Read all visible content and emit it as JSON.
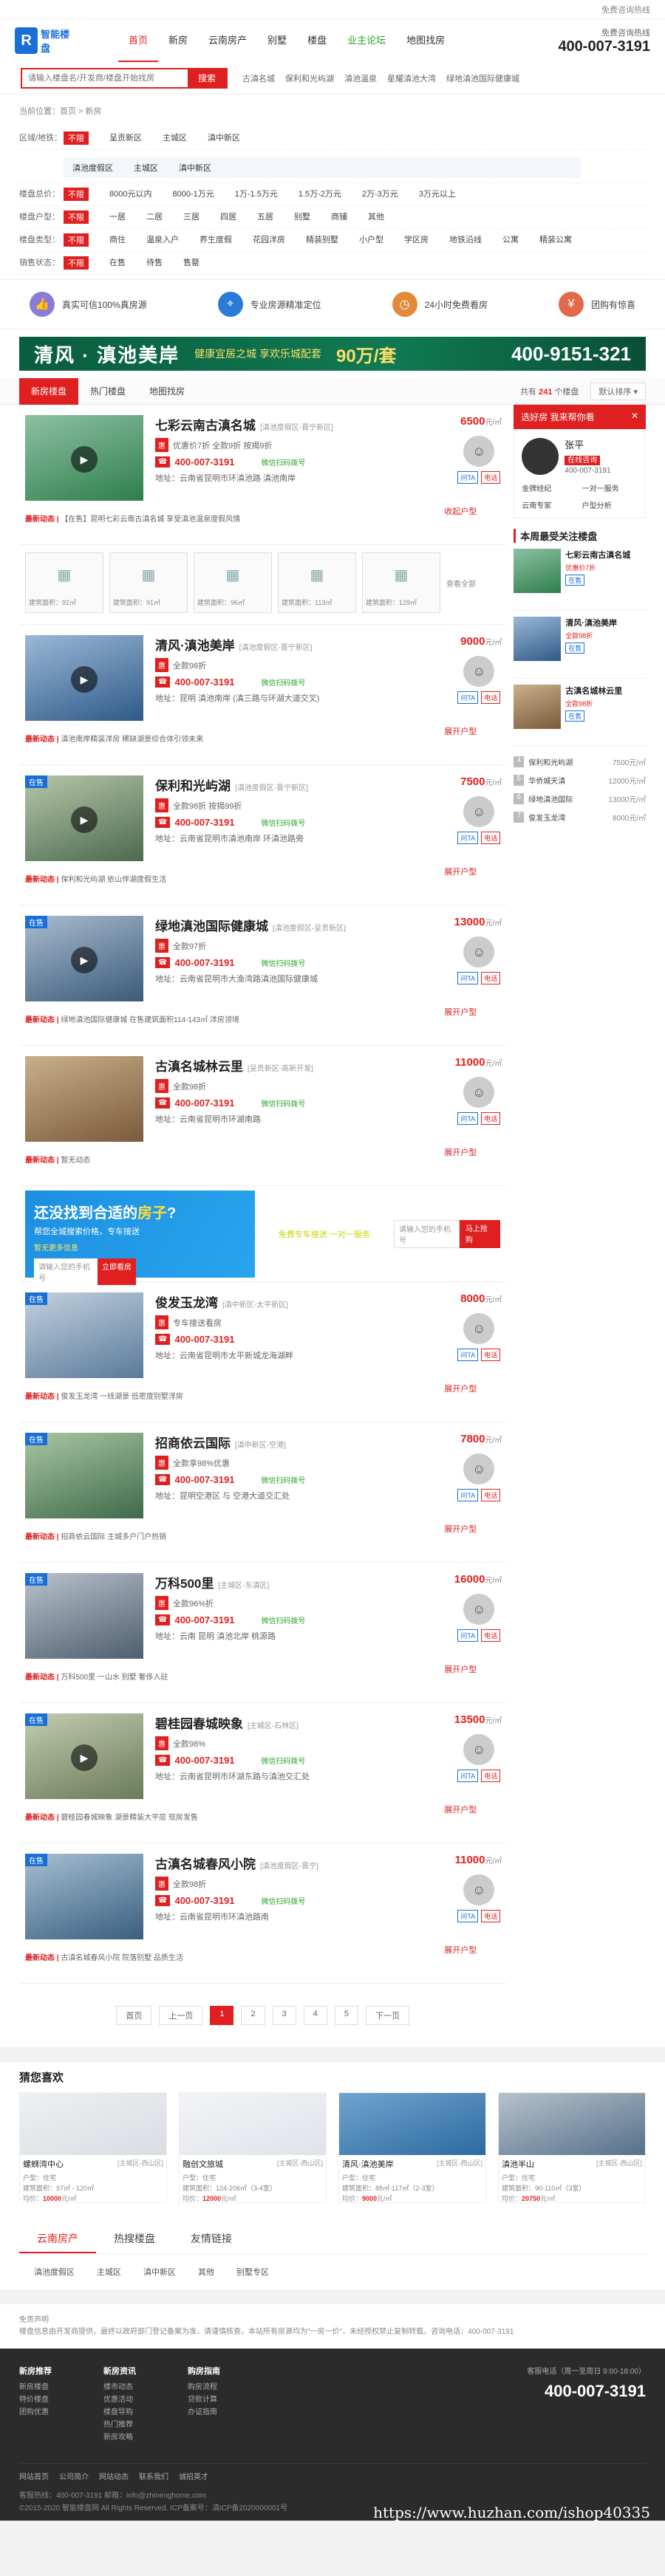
{
  "top": {
    "welcome": "",
    "hotline_label": "免费咨询热线",
    "hotline": "400-007-3191"
  },
  "logo": {
    "mark": "R",
    "text": "智能楼盘"
  },
  "nav": [
    "首页",
    "新房",
    "云南房产",
    "别墅",
    "楼盘",
    "业主论坛",
    "地图找房"
  ],
  "search": {
    "placeholder": "请输入楼盘名/开发商/楼盘开始找房",
    "button": "搜索",
    "hot": [
      "古滇名城",
      "保利和光屿湖",
      "滇池温泉",
      "星耀滇池大湾",
      "绿地滇池国际健康城"
    ]
  },
  "crumb": "当前位置：首页 > 新房",
  "filters": [
    {
      "label": "区域/地铁：",
      "opts": [
        "不限",
        "呈贡新区",
        "主城区",
        "滇中新区"
      ]
    },
    {
      "label": "",
      "sub": [
        "滇池度假区",
        "主城区",
        "滇中新区"
      ]
    },
    {
      "label": "楼盘总价：",
      "opts": [
        "不限",
        "8000元以内",
        "8000-1万元",
        "1万-1.5万元",
        "1.5万-2万元",
        "2万-3万元",
        "3万元以上"
      ]
    },
    {
      "label": "楼盘户型：",
      "opts": [
        "不限",
        "一居",
        "二居",
        "三居",
        "四居",
        "五居",
        "别墅",
        "商铺",
        "其他"
      ]
    },
    {
      "label": "楼盘类型：",
      "opts": [
        "不限",
        "商住",
        "温泉入户",
        "养生度假",
        "花园洋房",
        "精装别墅",
        "小户型",
        "学区房",
        "地铁沿线",
        "公寓",
        "精装公寓"
      ]
    },
    {
      "label": "销售状态：",
      "opts": [
        "不限",
        "在售",
        "待售",
        "售罄"
      ]
    }
  ],
  "features": [
    {
      "icon": "thumb-icon",
      "text": "真实可信100%真房源",
      "color": "#8a7bd8"
    },
    {
      "icon": "location-icon",
      "text": "专业房源精准定位",
      "color": "#2a7bd8"
    },
    {
      "icon": "clock-icon",
      "text": "24小时免费看房",
      "color": "#e08a3a"
    },
    {
      "icon": "sale-icon",
      "text": "团购有惊喜",
      "color": "#e06a4a"
    }
  ],
  "banner": {
    "t1": "清风 · 滇池美岸",
    "t2": "健康宜居之城  享欢乐城配套",
    "t3": "90万/套",
    "t4": "400-9151-321"
  },
  "tabs": {
    "items": [
      "新房楼盘",
      "热门楼盘",
      "地图找房"
    ],
    "total_prefix": "共有",
    "total": "241",
    "total_suffix": "个楼盘",
    "sort": "默认排序"
  },
  "list": [
    {
      "name": "七彩云南古滇名城",
      "area": "[滇池度假区-晋宁新区]",
      "price": "6500",
      "unit": "元/㎡",
      "tags": "优惠价7折  全款9折  按揭9折",
      "tel": "400-007-3191",
      "mini": "微信扫码拨号",
      "addr": "地址：云南省昆明市环滇池路 滇池南岸",
      "news": "【在售】昆明七彩云南古滇名城 享受滇池温泉度假风情",
      "tag": "",
      "video": true,
      "show": "收起户型"
    },
    {
      "name": "清风·滇池美岸",
      "area": "[滇池度假区-晋宁新区]",
      "price": "9000",
      "unit": "元/㎡",
      "tags": "全款98折",
      "tel": "400-007-3191",
      "mini": "微信扫码拨号",
      "addr": "地址：昆明  滇池南岸  (滇三路与环湖大道交叉)",
      "news": "滇池南岸精装洋房 稀缺湖景综合体引领未来",
      "tag": "",
      "video": true,
      "show": "展开户型"
    },
    {
      "name": "保利和光屿湖",
      "area": "[滇池度假区-晋宁新区]",
      "price": "7500",
      "unit": "元/㎡",
      "tags": "全款98折  按揭99折",
      "tel": "400-007-3191",
      "mini": "微信扫码拨号",
      "addr": "地址：云南省昆明市滇池南岸  环滇池路旁",
      "news": "保利和光屿湖 依山伴湖度假生活",
      "tag": "在售",
      "video": true,
      "show": "展开户型"
    },
    {
      "name": "绿地滇池国际健康城",
      "area": "[滇池度假区-呈贡新区]",
      "price": "13000",
      "unit": "元/㎡",
      "tags": "全款97折",
      "tel": "400-007-3191",
      "mini": "微信扫码拨号",
      "addr": "地址：云南省昆明市大渔湾路滇池国际健康城",
      "news": "绿地滇池国际健康城 在售建筑面积114-143㎡ 洋房领境",
      "tag": "在售",
      "video": true,
      "show": "展开户型"
    },
    {
      "name": "古滇名城林云里",
      "area": "[呈贡新区-高新开发]",
      "price": "11000",
      "unit": "元/㎡",
      "tags": "全款98折",
      "tel": "400-007-3191",
      "mini": "微信扫码拨号",
      "addr": "地址：云南省昆明市环湖南路",
      "news": "暂无动态",
      "tag": "",
      "video": false,
      "show": "展开户型"
    },
    {
      "name": "俊发玉龙湾",
      "area": "[滇中新区-太平新区]",
      "price": "8000",
      "unit": "元/㎡",
      "tags": "专车接送看房",
      "tel": "400-007-3191",
      "mini": "",
      "addr": "地址：云南省昆明市太平新城龙海湖畔",
      "news": "俊发玉龙湾 一线湖景 低密度别墅洋房",
      "tag": "在售",
      "video": false,
      "show": "展开户型"
    },
    {
      "name": "招商依云国际",
      "area": "[滇中新区-空港]",
      "price": "7800",
      "unit": "元/㎡",
      "tags": "全款享98%优惠",
      "tel": "400-007-3191",
      "mini": "微信扫码拨号",
      "addr": "地址：昆明空港区 与 空港大道交汇处",
      "news": "招商依云国际 主城多户门户热销",
      "tag": "在售",
      "video": false,
      "show": "展开户型"
    },
    {
      "name": "万科500里",
      "area": "[主城区-东滇区]",
      "price": "16000",
      "unit": "元/㎡",
      "tags": "全款96%折",
      "tel": "400-007-3191",
      "mini": "微信扫码拨号",
      "addr": "地址：云南 昆明 滇池北岸 桃源路",
      "news": "万科500里 一山水 别墅 奢侈入驻",
      "tag": "在售",
      "video": false,
      "show": "展开户型"
    },
    {
      "name": "碧桂园春城映象",
      "area": "[主城区-石林区]",
      "price": "13500",
      "unit": "元/㎡",
      "tags": "全款98%",
      "tel": "400-007-3191",
      "mini": "微信扫码拨号",
      "addr": "地址：云南省昆明市环湖东路与滇池交汇处",
      "news": "碧桂园春城映象 湖景精装大平层 现房发售",
      "tag": "在售",
      "video": true,
      "show": "展开户型"
    },
    {
      "name": "古滇名城春风小院",
      "area": "[滇池度假区-晋宁]",
      "price": "11000",
      "unit": "元/㎡",
      "tags": "全款98折",
      "tel": "400-007-3191",
      "mini": "微信扫码拨号",
      "addr": "地址：云南省昆明市环滇池路南",
      "news": "古滇名城春风小院 院落别墅 品质生活",
      "tag": "在售",
      "video": false,
      "show": "展开户型"
    }
  ],
  "hutypes": [
    {
      "cap": "建筑面积：92㎡"
    },
    {
      "cap": "建筑面积：91㎡"
    },
    {
      "cap": "建筑面积：96㎡"
    },
    {
      "cap": "建筑面积：113㎡"
    },
    {
      "cap": "建筑面积：129㎡"
    }
  ],
  "hu_more": "查看全部",
  "promo": {
    "t1a": "还没找到合适的",
    "t1b": "房子",
    "t1c": "?",
    "t2": "帮您全城搜索价格，专车接送",
    "t3": "暂无更多信息",
    "phone": "请输入您的手机号",
    "btn": "立即看房",
    "mid": "免费专车接送  一对一服务",
    "phone2": "请输入您的手机号",
    "btn2": "马上抢购"
  },
  "pager": [
    "首页",
    "上一页",
    "1",
    "2",
    "3",
    "4",
    "5",
    "下一页"
  ],
  "side": {
    "head": "选好房 我来帮你看",
    "agent_name": "张平",
    "agent_badge": "在线咨询",
    "agent_phone": "400-007-3191",
    "grid": [
      "金牌经纪",
      "一对一服务",
      "云南专家",
      "户型分析"
    ],
    "title": "本周最受关注楼盘",
    "items": [
      {
        "name": "七彩云南古滇名城",
        "sub": "优惠价7折",
        "tag": "在售"
      },
      {
        "name": "清风·滇池美岸",
        "sub": "全款98折",
        "tag": "在售"
      },
      {
        "name": "古滇名城林云里",
        "sub": "全款98折",
        "tag": "在售"
      }
    ],
    "rank": [
      {
        "n": "4",
        "name": "保利和光屿湖",
        "p": "7500元/㎡"
      },
      {
        "n": "5",
        "name": "华侨城天滇",
        "p": "12000元/㎡"
      },
      {
        "n": "6",
        "name": "绿地滇池国际",
        "p": "13000元/㎡"
      },
      {
        "n": "7",
        "name": "俊发玉龙湾",
        "p": "8000元/㎡"
      }
    ]
  },
  "guess": {
    "title": "猜您喜欢",
    "cards": [
      {
        "name": "螺蛳湾中心",
        "area": "[主城区-西山区]",
        "type": "住宅",
        "size": "建筑面积：97㎡ - 120㎡",
        "price": "10000",
        "c1": "#d9dde2",
        "c2": "#eef0f2"
      },
      {
        "name": "融创文旅城",
        "area": "[主城区-西山区]",
        "type": "住宅",
        "size": "建筑面积：124-206㎡（3-4室）",
        "price": "12000",
        "c1": "#dfe3ea",
        "c2": "#f3f4f6"
      },
      {
        "name": "清风·滇池美岸",
        "area": "[主城区-西山区]",
        "type": "住宅",
        "size": "建筑面积：88㎡-117㎡（2-3室）",
        "price": "9000",
        "c1": "#2d6aa0",
        "c2": "#6fa4cf"
      },
      {
        "name": "滇池半山",
        "area": "[主城区-西山区]",
        "type": "住宅",
        "size": "建筑面积：90-110㎡（3室）",
        "price": "20750",
        "c1": "#56708a",
        "c2": "#b6c2cc"
      }
    ]
  },
  "linktabs": [
    "云南房产",
    "热搜楼盘",
    "友情链接"
  ],
  "links": [
    "滇池度假区",
    "主城区",
    "滇中新区",
    "其他",
    "别墅专区"
  ],
  "notice": "免责声明\n楼盘信息由开发商提供，最终以政府部门登记备案为准，请谨慎核查。本站所有房源均为\"一房一价\"，未经授权禁止复制转载。咨询电话：400-007-3191",
  "footer": {
    "cols": [
      {
        "h": "新房推荐",
        "items": [
          "新房楼盘",
          "特价楼盘",
          "团购优惠"
        ]
      },
      {
        "h": "新房资讯",
        "items": [
          "楼市动态",
          "优惠活动",
          "楼盘导购",
          "热门推荐",
          "新房攻略"
        ]
      },
      {
        "h": "购房指南",
        "items": [
          "购房流程",
          "贷款计算",
          "办证指南"
        ]
      }
    ],
    "srv_label": "客服电话（周一至周日 9:00-18:00）",
    "srv": "400-007-3191",
    "links": [
      "网站首页",
      "公司简介",
      "网站动态",
      "联系我们",
      "诚招英才"
    ],
    "cp1": "客服热线：400-007-3191  邮箱：info@zhinenghome.com",
    "cp2": "©2015-2020 智能楼盘网 All Rights Reserved. ICP备案号：滇ICP备2020000001号"
  },
  "watermark": "https://www.huzhan.com/ishop40335"
}
